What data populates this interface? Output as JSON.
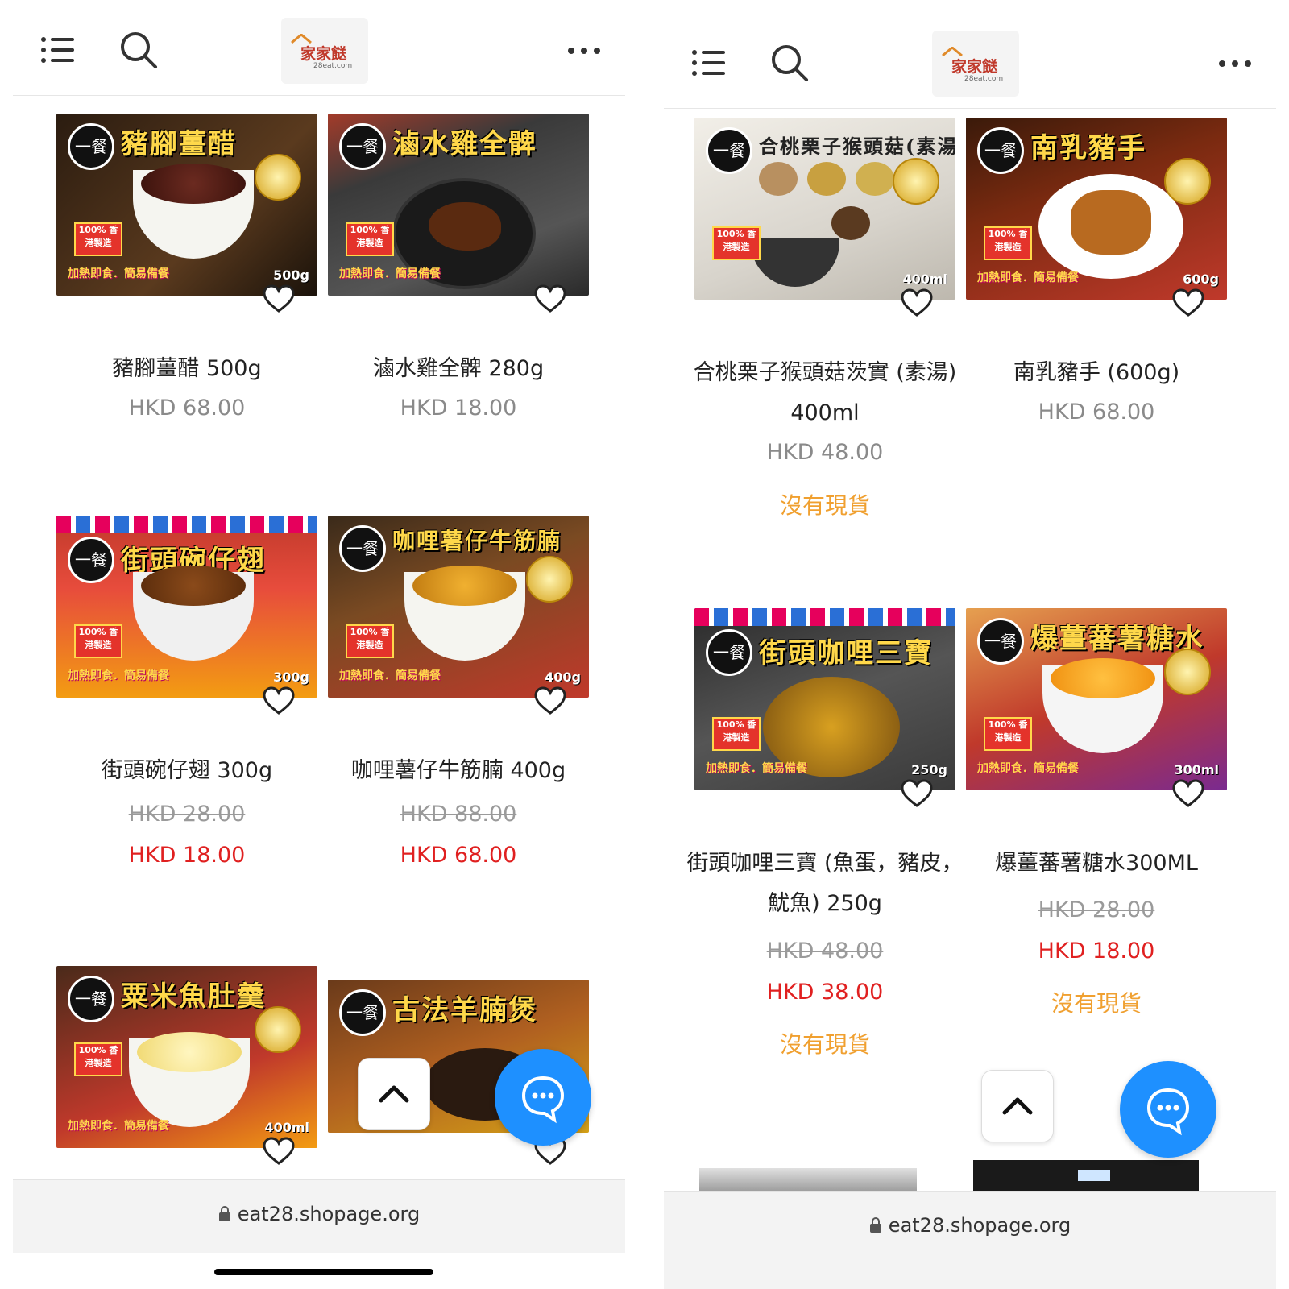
{
  "left_screen": {
    "header": {
      "logo_brand": "家家餸",
      "logo_domain": "28eat.com"
    },
    "products": [
      {
        "name": "豬腳薑醋 500g",
        "price": "HKD 68.00",
        "original_price": "",
        "sale_price": "",
        "status": "",
        "img_title": "豬腳薑醋",
        "img_weight": "500g"
      },
      {
        "name": "滷水雞全髀 280g",
        "price": "HKD 18.00",
        "original_price": "",
        "sale_price": "",
        "status": "",
        "img_title": "滷水雞全髀",
        "img_weight": ""
      },
      {
        "name": "街頭碗仔翅 300g",
        "price": "",
        "original_price": "HKD 28.00",
        "sale_price": "HKD 18.00",
        "status": "",
        "img_title": "街頭碗仔翅",
        "img_weight": "300g"
      },
      {
        "name": "咖哩薯仔牛筋腩 400g",
        "price": "",
        "original_price": "HKD 88.00",
        "sale_price": "HKD 68.00",
        "status": "",
        "img_title": "咖哩薯仔牛筋腩",
        "img_weight": "400g"
      },
      {
        "img_title": "粟米魚肚羹",
        "img_weight": "400ml"
      },
      {
        "img_title": "古法羊腩煲",
        "img_weight": ""
      }
    ],
    "url": "eat28.shopage.org"
  },
  "right_screen": {
    "header": {
      "logo_brand": "家家餸",
      "logo_domain": "28eat.com"
    },
    "products": [
      {
        "name": "合桃栗子猴頭菇茨實 (素湯) 400ml",
        "price": "HKD 48.00",
        "original_price": "",
        "sale_price": "",
        "status": "沒有現貨",
        "img_title": "合桃栗子猴頭菇(素湯)",
        "img_weight": "400ml"
      },
      {
        "name": "南乳豬手 (600g)",
        "price": "HKD 68.00",
        "original_price": "",
        "sale_price": "",
        "status": "",
        "img_title": "南乳豬手",
        "img_weight": "600g"
      },
      {
        "name": "街頭咖哩三寶 (魚蛋，豬皮，魷魚) 250g",
        "price": "",
        "original_price": "HKD 48.00",
        "sale_price": "HKD 38.00",
        "status": "沒有現貨",
        "img_title": "街頭咖哩三寶",
        "img_weight": "250g"
      },
      {
        "name": "爆薑蕃薯糖水300ML",
        "price": "",
        "original_price": "HKD 28.00",
        "sale_price": "HKD 18.00",
        "status": "沒有現貨",
        "img_title": "爆薑蕃薯糖水",
        "img_weight": "300ml"
      }
    ],
    "url": "eat28.shopage.org"
  },
  "image_common": {
    "seal_text": "一餐",
    "badge_text": "100% 香港製造",
    "tagline": "加熱即食．簡易備餐"
  },
  "colors": {
    "sale_red": "#e02020",
    "soldout_orange": "#f0a030",
    "chat_blue": "#1e90ff",
    "title_yellow": "#ffd84a"
  },
  "icons": [
    "menu-icon",
    "search-icon",
    "more-icon",
    "heart-icon",
    "chevron-up-icon",
    "chat-icon",
    "lock-icon"
  ]
}
